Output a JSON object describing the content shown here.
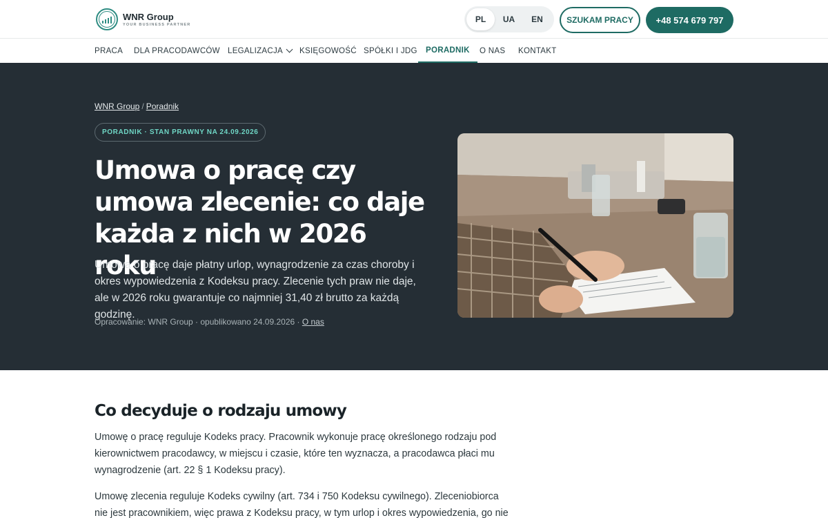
{
  "brand": {
    "name": "WNR Group",
    "tagline": "YOUR BUSINESS PARTNER",
    "accent": "#1e6b63",
    "dark_bg": "#252e35"
  },
  "header": {
    "languages": [
      {
        "code": "PL",
        "active": true
      },
      {
        "code": "UA",
        "active": false
      },
      {
        "code": "EN",
        "active": false
      }
    ],
    "jobs_button": "SZUKAM PRACY",
    "phone_button": "+48 574 679 797"
  },
  "nav": {
    "items": [
      {
        "label": "PRACA"
      },
      {
        "label": "DLA PRACODAWCÓW"
      },
      {
        "label": "LEGALIZACJA",
        "has_dropdown": true
      },
      {
        "label": "KSIĘGOWOŚĆ"
      },
      {
        "label": "SPÓŁKI I JDG"
      },
      {
        "label": "PORADNIK",
        "active": true
      },
      {
        "label": "O NAS"
      },
      {
        "label": "KONTAKT"
      }
    ]
  },
  "hero": {
    "breadcrumb": [
      "WNR Group",
      "Poradnik"
    ],
    "badge": "PORADNIK · STAN PRAWNY NA 24.09.2026",
    "title": "Umowa o pracę czy umowa zlecenie: co daje każda z nich w 2026 roku",
    "lead": "Umowa o pracę daje płatny urlop, wynagrodzenie za czas choroby i okres wypowiedzenia z Kodeksu pracy. Zlecenie tych praw nie daje, ale w 2026 roku gwarantuje co najmniej 31,40 zł brutto za każdą godzinę.",
    "meta_prefix": "Opracowanie: WNR Group · opublikowano 24.09.2026 · ",
    "meta_link": "O nas"
  },
  "content": {
    "section_title": "Co decyduje o rodzaju umowy",
    "paragraphs": [
      "Umowę o pracę reguluje Kodeks pracy. Pracownik wykonuje pracę określonego rodzaju pod kierownictwem pracodawcy, w miejscu i czasie, które ten wyznacza, a pracodawca płaci mu wynagrodzenie (art. 22 § 1 Kodeksu pracy).",
      "Umowę zlecenia reguluje Kodeks cywilny (art. 734 i 750 Kodeksu cywilnego). Zleceniobiorca nie jest pracownikiem, więc prawa z Kodeksu pracy, w tym urlop i okres wypowiedzenia, go nie"
    ]
  }
}
